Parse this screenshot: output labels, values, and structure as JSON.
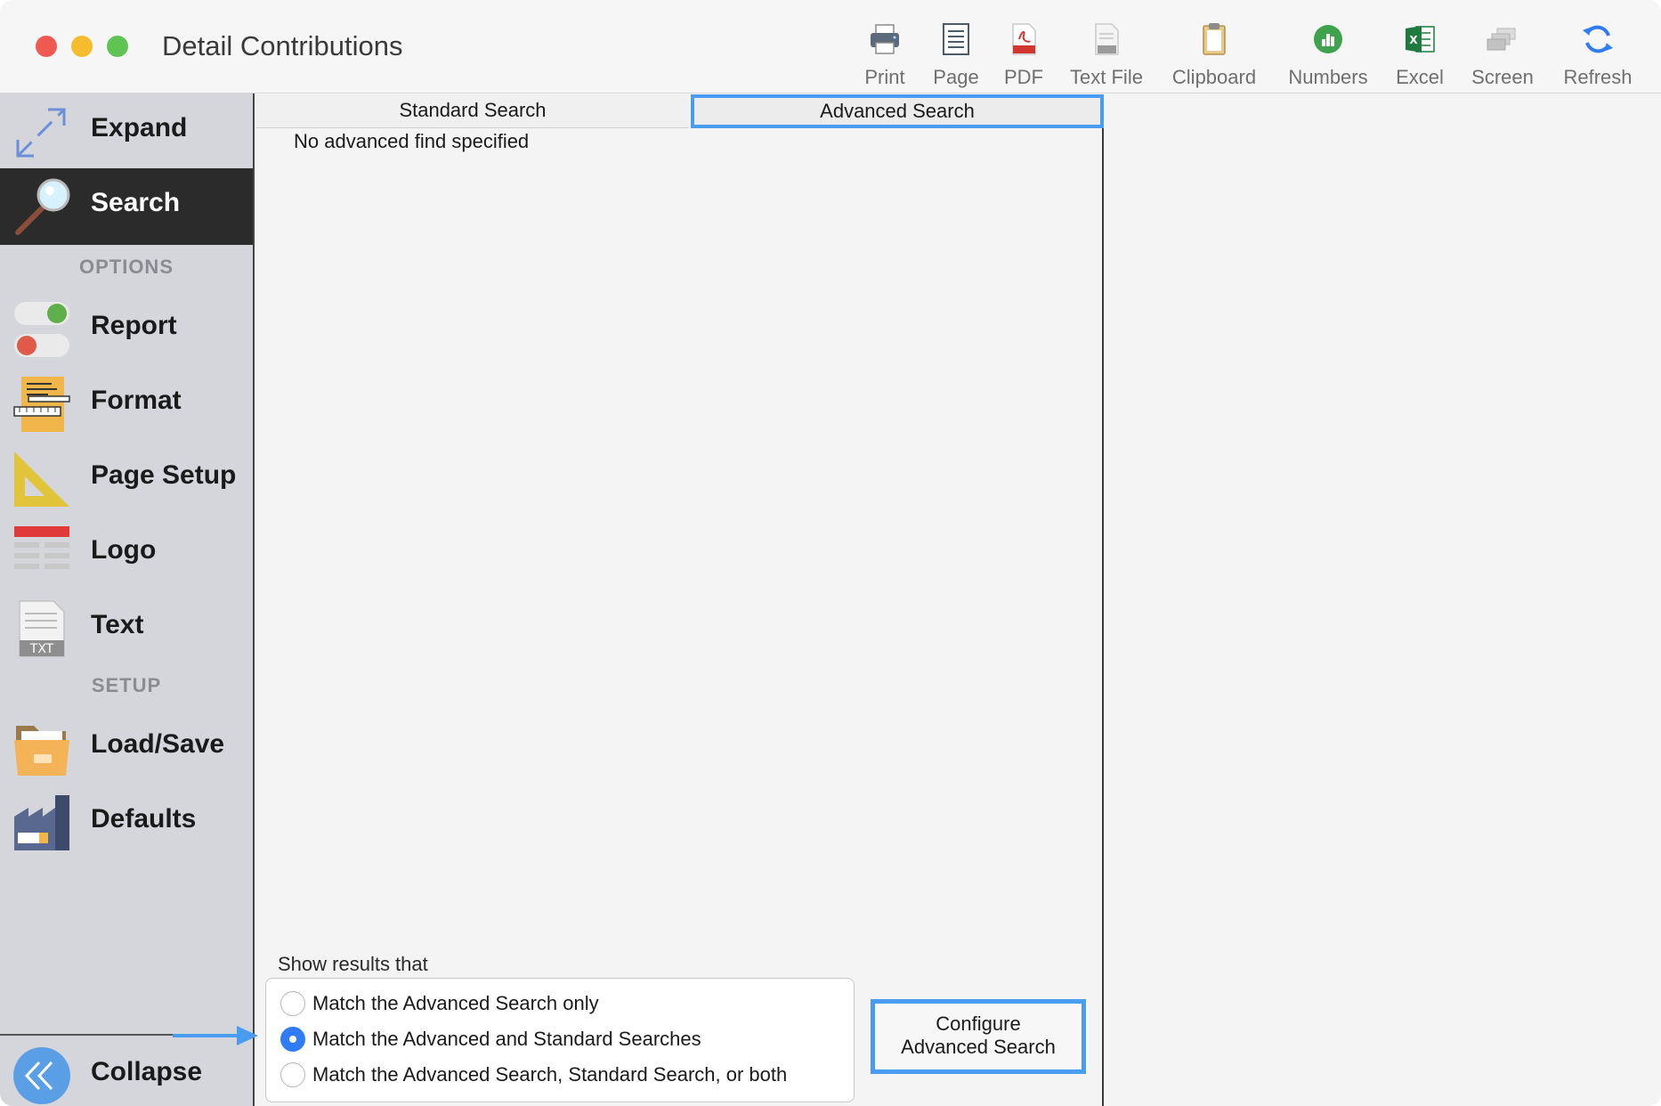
{
  "window": {
    "title": "Detail Contributions"
  },
  "toolbar": {
    "items": [
      {
        "label": "Print",
        "icon": "printer-icon"
      },
      {
        "label": "Page",
        "icon": "page-icon"
      },
      {
        "label": "PDF",
        "icon": "pdf-icon"
      },
      {
        "label": "Text File",
        "icon": "text-file-icon"
      },
      {
        "label": "Clipboard",
        "icon": "clipboard-icon"
      },
      {
        "label": "Numbers",
        "icon": "numbers-icon"
      },
      {
        "label": "Excel",
        "icon": "excel-icon"
      },
      {
        "label": "Screen",
        "icon": "screen-icon"
      },
      {
        "label": "Refresh",
        "icon": "refresh-icon"
      }
    ]
  },
  "sidebar": {
    "expand": "Expand",
    "search": "Search",
    "options_heading": "OPTIONS",
    "report": "Report",
    "format": "Format",
    "page_setup": "Page Setup",
    "logo": "Logo",
    "text": "Text",
    "setup_heading": "SETUP",
    "load_save": "Load/Save",
    "defaults": "Defaults",
    "collapse": "Collapse",
    "active": "Search"
  },
  "main": {
    "tabs": [
      {
        "label": "Standard Search",
        "selected": false
      },
      {
        "label": "Advanced Search",
        "selected": true
      }
    ],
    "empty_message": "No advanced find specified",
    "show_results_label": "Show results that",
    "radio_options": [
      {
        "label": "Match the Advanced Search only",
        "selected": false
      },
      {
        "label": "Match the Advanced and Standard Searches",
        "selected": true
      },
      {
        "label": "Match the Advanced Search, Standard Search, or both",
        "selected": false
      }
    ],
    "configure_button": {
      "line1": "Configure",
      "line2": "Advanced Search"
    }
  },
  "colors": {
    "accent": "#4a9cf0",
    "radio_selected": "#2f7cf6",
    "sidebar_bg": "#d4d6dc",
    "sidebar_active_bg": "#2b2b2b",
    "close": "#ee5a52",
    "minimize": "#f5bd2e",
    "zoom": "#5fc453"
  }
}
